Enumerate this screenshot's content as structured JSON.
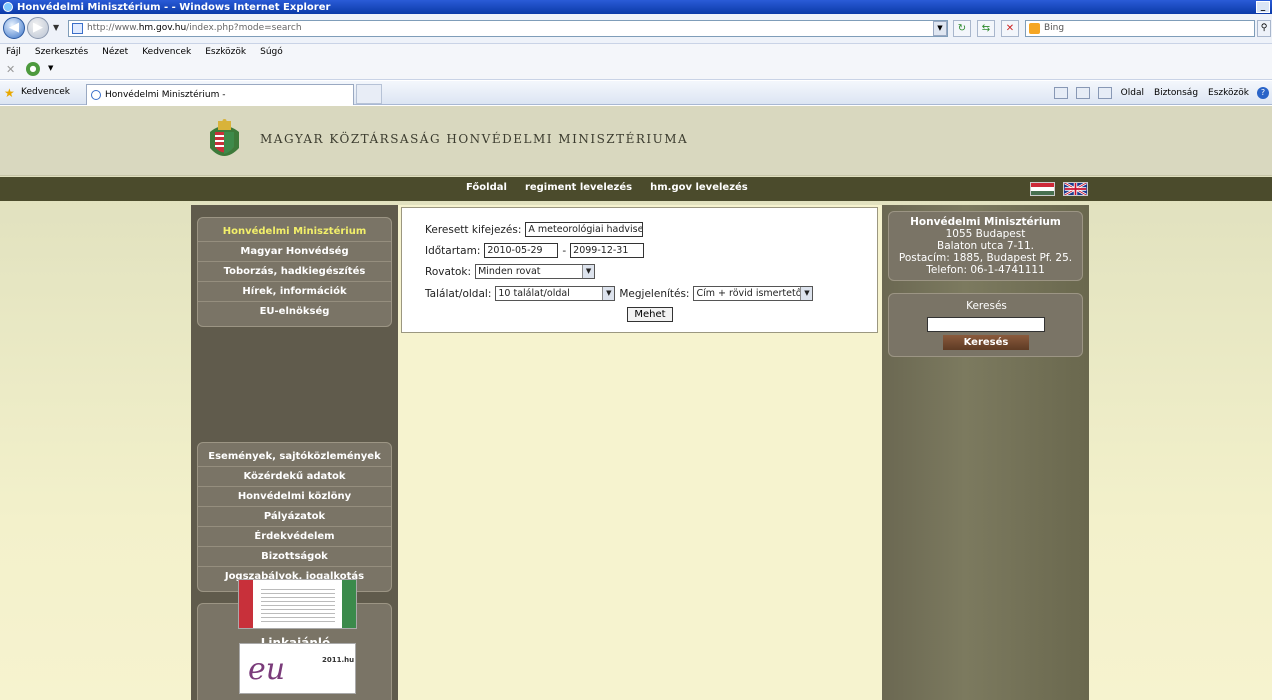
{
  "window": {
    "title": "Honvédelmi Minisztérium - - Windows Internet Explorer",
    "control": "_"
  },
  "address": {
    "url_prefix": "http://www.",
    "url_domain": "hm.gov.hu",
    "url_path": "/index.php?mode=search"
  },
  "search_engine": {
    "placeholder": "Bing"
  },
  "menu": [
    "Fájl",
    "Szerkesztés",
    "Nézet",
    "Kedvencek",
    "Eszközök",
    "Súgó"
  ],
  "favorites": {
    "label": "Kedvencek",
    "tab_title": "Honvédelmi Minisztérium -"
  },
  "commands": {
    "page": "Oldal",
    "safety": "Biztonság",
    "tools": "Eszközök"
  },
  "site": {
    "title": "MAGYAR KÖZTÁRSASÁG HONVÉDELMI MINISZTÉRIUMA",
    "nav": [
      "Főoldal",
      "regiment levelezés",
      "hm.gov levelezés"
    ],
    "left_menu_a": [
      "Honvédelmi Minisztérium",
      "Magyar Honvédség",
      "Toborzás, hadkiegészítés",
      "Hírek, információk",
      "EU-elnökség"
    ],
    "left_menu_b": [
      "Események, sajtóközlemények",
      "Közérdekű adatok",
      "Honvédelmi közlöny",
      "Pályázatok",
      "Érdekvédelem",
      "Bizottságok",
      "Jogszabályok, jogalkotás"
    ],
    "link_box_title": "Linkajánló",
    "banner2_year": "2011.hu",
    "banner2_logo": "eu"
  },
  "search_form": {
    "query_label": "Keresett kifejezés:",
    "query_value": "A meteorológiai hadvise",
    "period_label": "Időtartam:",
    "date_from": "2010-05-29",
    "date_sep": "-",
    "date_to": "2099-12-31",
    "section_label": "Rovatok:",
    "section_value": "Minden rovat",
    "per_page_label": "Találat/oldal:",
    "per_page_value": "10 találat/oldal",
    "display_label": "Megjelenítés:",
    "display_value": "Cím + rövid ismertető",
    "submit": "Mehet"
  },
  "contact": {
    "org": "Honvédelmi Minisztérium",
    "city": "1055 Budapest",
    "street": "Balaton utca 7-11.",
    "postal": "Postacím: 1885, Budapest Pf. 25.",
    "phone": "Telefon: 06-1-4741111"
  },
  "side_search": {
    "title": "Keresés",
    "button": "Keresés"
  }
}
